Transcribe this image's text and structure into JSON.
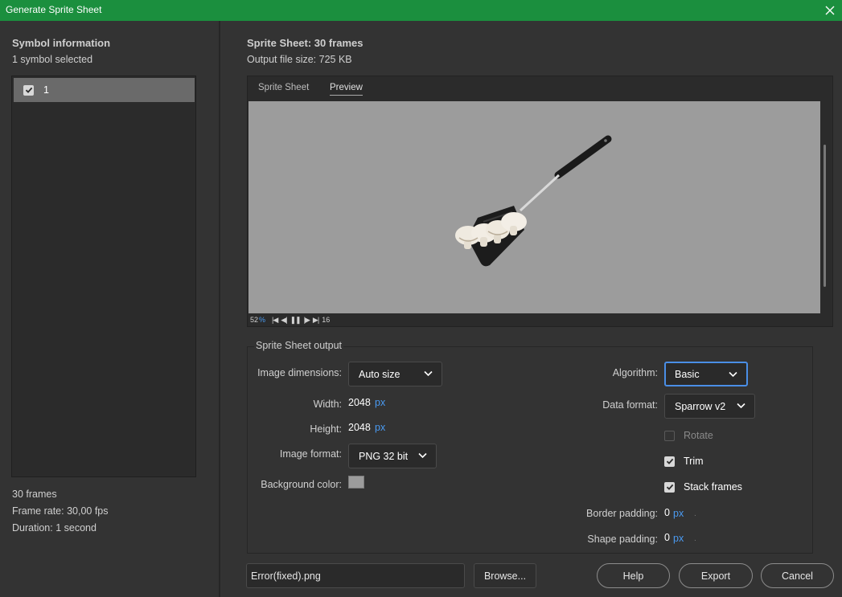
{
  "window": {
    "title": "Generate Sprite Sheet"
  },
  "symbol_info": {
    "heading": "Symbol information",
    "selected_count": "1 symbol selected",
    "symbols": [
      {
        "label": "1",
        "checked": true
      }
    ],
    "frames": "30 frames",
    "frame_rate": "Frame rate: 30,00 fps",
    "duration": "Duration: 1 second"
  },
  "sprite_sheet": {
    "heading": "Sprite Sheet: 30 frames",
    "file_size": "Output file size: 725 KB"
  },
  "tabs": [
    {
      "label": "Sprite Sheet",
      "active": false
    },
    {
      "label": "Preview",
      "active": true
    }
  ],
  "preview_controls": {
    "zoom_value": "52",
    "zoom_unit": "%",
    "first_frame": "|◀",
    "step_back": "◀|",
    "pause": "❚❚",
    "step_forward": "|▶",
    "last_frame": "▶|",
    "current_frame": "16"
  },
  "output": {
    "legend": "Sprite Sheet output",
    "image_dimensions": {
      "label": "Image dimensions:",
      "value": "Auto size"
    },
    "width": {
      "label": "Width:",
      "value": "2048",
      "unit": "px"
    },
    "height": {
      "label": "Height:",
      "value": "2048",
      "unit": "px"
    },
    "image_format": {
      "label": "Image format:",
      "value": "PNG 32 bit"
    },
    "background_color": {
      "label": "Background color:",
      "color": "#9c9c9c"
    },
    "algorithm": {
      "label": "Algorithm:",
      "value": "Basic"
    },
    "data_format": {
      "label": "Data format:",
      "value": "Sparrow v2"
    },
    "rotate": {
      "label": "Rotate",
      "checked": false,
      "enabled": false
    },
    "trim": {
      "label": "Trim",
      "checked": true
    },
    "stack_frames": {
      "label": "Stack frames",
      "checked": true
    },
    "border_padding": {
      "label": "Border padding:",
      "value": "0",
      "unit": "px"
    },
    "shape_padding": {
      "label": "Shape padding:",
      "value": "0",
      "unit": "px"
    }
  },
  "footer": {
    "filename": "Error(fixed).png",
    "browse": "Browse...",
    "help": "Help",
    "export": "Export",
    "cancel": "Cancel"
  },
  "colors": {
    "title_bar": "#1b8f3e",
    "background": "#333333",
    "accent": "#4a9bf2",
    "canvas": "#9c9c9c"
  },
  "icons": [
    "close-icon",
    "checkbox-icon",
    "chevron-down-icon"
  ]
}
